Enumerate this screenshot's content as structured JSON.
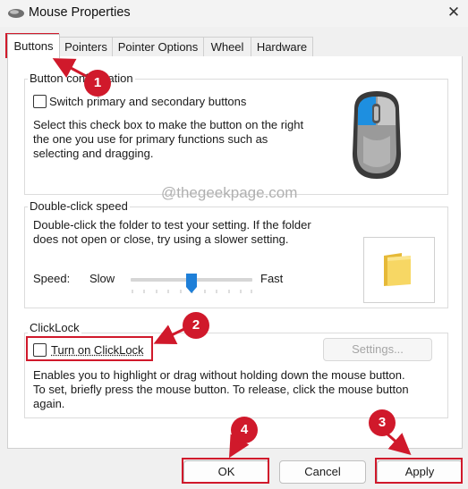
{
  "window": {
    "title": "Mouse Properties",
    "close_glyph": "✕"
  },
  "tabs": [
    {
      "label": "Buttons",
      "active": true
    },
    {
      "label": "Pointers",
      "active": false
    },
    {
      "label": "Pointer Options",
      "active": false
    },
    {
      "label": "Wheel",
      "active": false
    },
    {
      "label": "Hardware",
      "active": false
    }
  ],
  "button_config": {
    "group_label": "Button configuration",
    "checkbox_label": "Switch primary and secondary buttons",
    "checked": false,
    "description": [
      "Select this check box to make the button on the right",
      "the one you use for primary functions such as",
      "selecting and dragging."
    ]
  },
  "double_click": {
    "group_label": "Double-click speed",
    "description": [
      "Double-click the folder to test your setting. If the folder",
      "does not open or close, try using a slower setting."
    ],
    "speed_label": "Speed:",
    "slow_label": "Slow",
    "fast_label": "Fast",
    "slider_fraction": 0.5
  },
  "clicklock": {
    "group_label": "ClickLock",
    "checkbox_label": "Turn on ClickLock",
    "checked": false,
    "settings_label": "Settings...",
    "description": [
      "Enables you to highlight or drag without holding down the mouse button.",
      "To set, briefly press the mouse button. To release, click the mouse button",
      "again."
    ]
  },
  "watermark": "@thegeekpage.com",
  "footer": {
    "ok_label": "OK",
    "cancel_label": "Cancel",
    "apply_label": "Apply"
  },
  "annotations": {
    "badge1": "1",
    "badge2": "2",
    "badge3": "3",
    "badge4": "4"
  },
  "colors": {
    "annotation_red": "#d0192b",
    "mouse_blue": "#1e8fe0"
  },
  "icons": [
    "mouse-icon",
    "close-icon",
    "folder-icon",
    "mouse-illustration"
  ]
}
